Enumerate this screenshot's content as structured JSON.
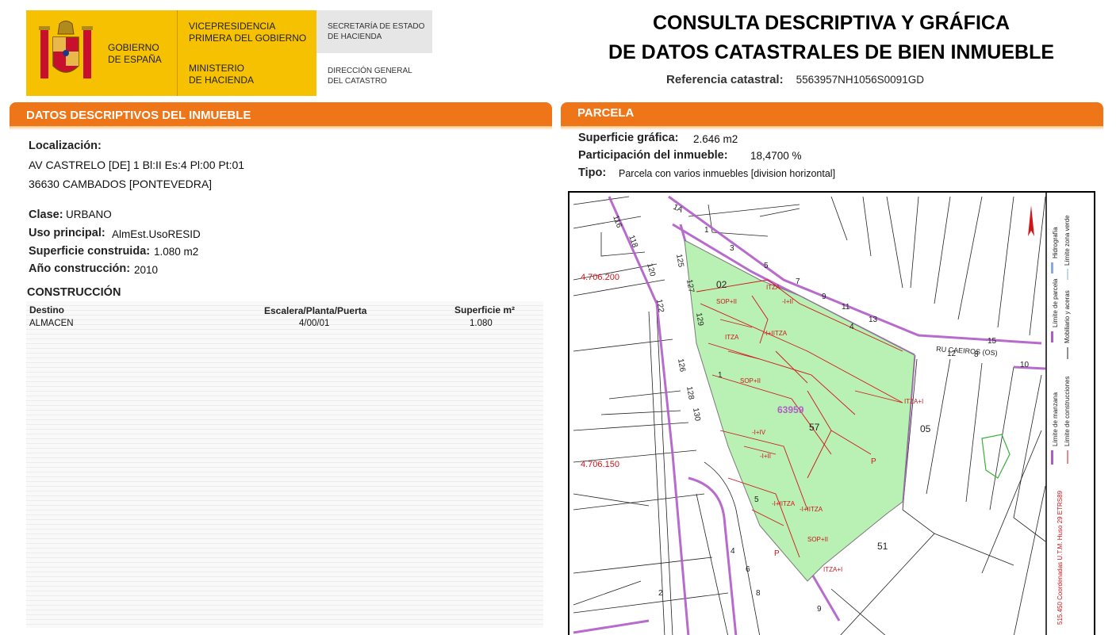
{
  "header": {
    "gov_name": [
      "GOBIERNO",
      "DE ESPAÑA"
    ],
    "vice": [
      "VICEPRESIDENCIA",
      "PRIMERA DEL GOBIERNO"
    ],
    "ministry": [
      "MINISTERIO",
      "DE HACIENDA"
    ],
    "secretary": [
      "SECRETARÍA DE ESTADO",
      "DE HACIENDA"
    ],
    "direction": [
      "DIRECCIÓN GENERAL",
      "DEL CATASTRO"
    ],
    "title_line1": "CONSULTA DESCRIPTIVA Y GRÁFICA",
    "title_line2": "DE DATOS CATASTRALES DE BIEN INMUEBLE",
    "ref_label": "Referencia catastral:",
    "ref_value": "5563957NH1056S0091GD"
  },
  "left": {
    "section_title": "DATOS DESCRIPTIVOS DEL INMUEBLE",
    "localizacion_label": "Localización:",
    "address_line1": "AV CASTRELO [DE] 1 Bl:II Es:4 Pl:00 Pt:01",
    "address_line2": "36630 CAMBADOS [PONTEVEDRA]",
    "clase_label": "Clase:",
    "clase_value": "URBANO",
    "uso_label": "Uso principal:",
    "uso_value": "AlmEst.UsoRESID",
    "sup_label": "Superficie construida:",
    "sup_value": "1.080 m2",
    "anio_label": "Año construcción:",
    "anio_value": "2010",
    "construccion_title": "CONSTRUCCIÓN",
    "table": {
      "headers": [
        "Destino",
        "Escalera/Planta/Puerta",
        "Superficie m²"
      ],
      "rows": [
        [
          "ALMACEN",
          "4/00/01",
          "1.080"
        ]
      ]
    }
  },
  "right": {
    "section_title": "PARCELA",
    "sup_grafica_label": "Superficie gráfica:",
    "sup_grafica_value": "2.646 m2",
    "participacion_label": "Participación del inmueble:",
    "participacion_value": "18,4700 %",
    "tipo_label": "Tipo:",
    "tipo_value": "Parcela con varios inmuebles [division horizontal]"
  },
  "map": {
    "coord_y1": "4.706.200",
    "coord_y2": "4.706.150",
    "coord_x": "515.450 Coordenadas U.T.M. Huso 29 ETRS89",
    "street": "RU CAEIROS (OS)",
    "parcel_labels": [
      "02",
      "57",
      "05",
      "51"
    ],
    "parcel_id": "63959",
    "numbers": [
      "116",
      "118",
      "120",
      "122",
      "125",
      "127",
      "129",
      "126",
      "128",
      "130",
      "1A",
      "1",
      "3",
      "5",
      "7",
      "9",
      "11",
      "13",
      "4",
      "15",
      "12",
      "8",
      "10",
      "1",
      "5",
      "4",
      "6",
      "8",
      "2",
      "9",
      "P",
      "P"
    ],
    "construction_labels": [
      "ITZA",
      "SOP+II",
      "-I+II",
      "-I+IITZA",
      "-I+IV",
      "ITZA+I",
      "-I+IITZA"
    ],
    "legend": {
      "col1": [
        "Límite de manzana",
        "Límite de parcela",
        "Hidrografía"
      ],
      "col2": [
        "Límite de construcciones",
        "Mobiliario y aceras",
        "Límite zona verde"
      ]
    }
  }
}
